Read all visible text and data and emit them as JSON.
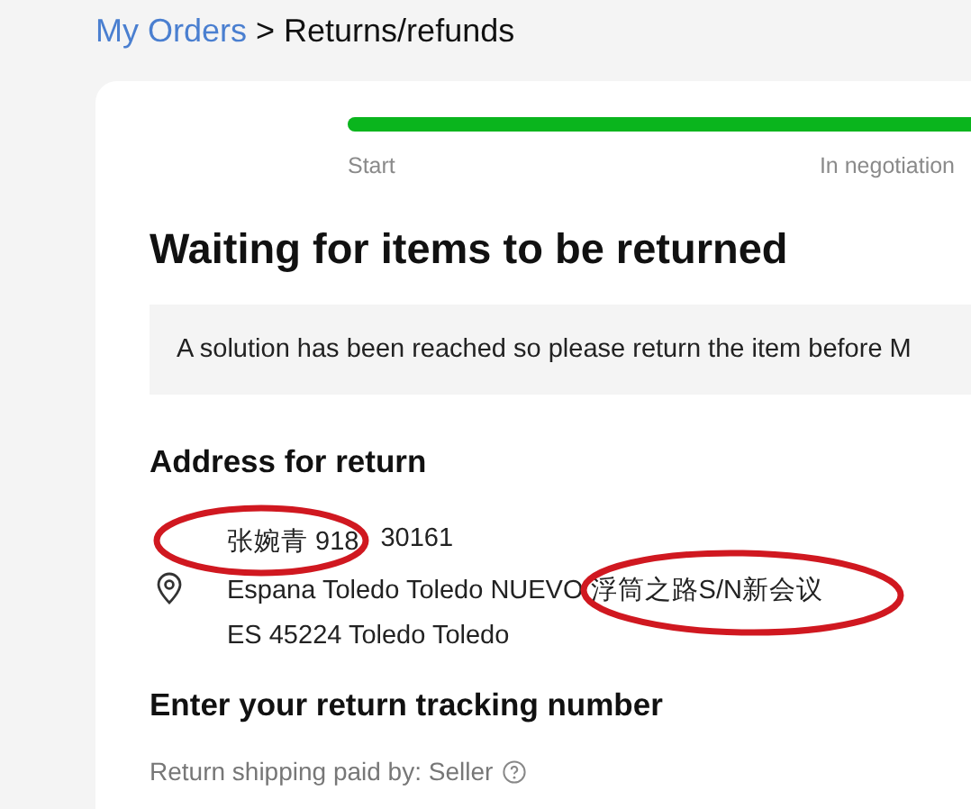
{
  "breadcrumb": {
    "link": "My Orders",
    "separator": ">",
    "current": "Returns/refunds"
  },
  "progress": {
    "level": 1,
    "steps": [
      {
        "label": "Start"
      },
      {
        "label": "In negotiation"
      }
    ]
  },
  "title": "Waiting for items to be returned",
  "notice": "A solution has been reached so please return the item before M",
  "address": {
    "heading": "Address for return",
    "name_line": [
      "张婉青 918",
      "30161"
    ],
    "street": "Espana Toledo Toledo NUEVO 浮筒之路S/N新会议",
    "city": "ES 45224 Toledo Toledo"
  },
  "tracking": {
    "heading": "Enter your return tracking number",
    "paid_by": "Return shipping paid by: Seller"
  },
  "annotations": [
    {
      "kind": "ellipse",
      "color": "#d01820"
    },
    {
      "kind": "ellipse",
      "color": "#d01820"
    }
  ]
}
